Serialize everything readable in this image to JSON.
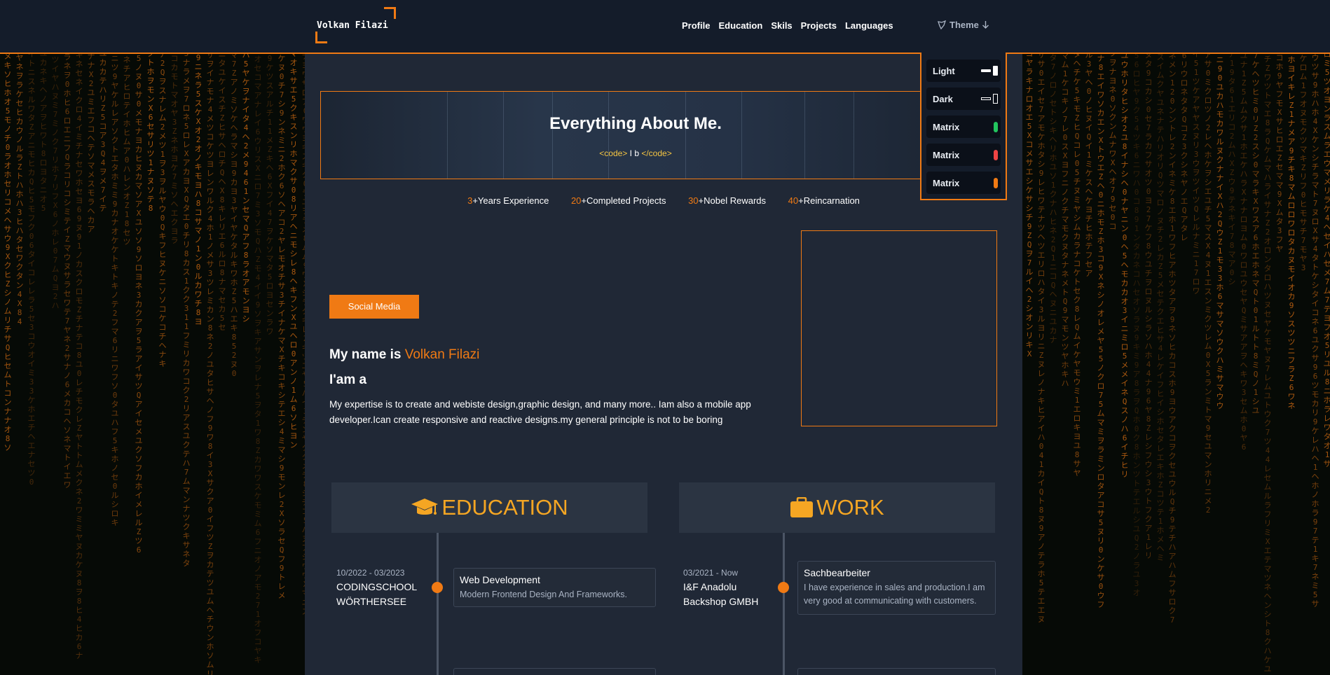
{
  "navbar": {
    "brand": "Volkan Filazi",
    "links": [
      "Profile",
      "Education",
      "Skils",
      "Projects",
      "Languages"
    ],
    "theme_label": "Theme"
  },
  "theme_menu": {
    "items": [
      {
        "label": "Light",
        "swatch": "light"
      },
      {
        "label": "Dark",
        "swatch": "dark"
      },
      {
        "label": "Matrix",
        "swatch": "#22c55e"
      },
      {
        "label": "Matrix",
        "swatch": "#ef4444"
      },
      {
        "label": "Matrix",
        "swatch": "#f07a14"
      }
    ]
  },
  "hero": {
    "title": "Everything About Me.",
    "code_open": "<code>",
    "code_text": "I b",
    "code_close": "</code>"
  },
  "stats": [
    {
      "num": "3",
      "label": "+Years Experience"
    },
    {
      "num": "20",
      "label": "+Completed Projects"
    },
    {
      "num": "30",
      "label": "+Nobel Rewards"
    },
    {
      "num": "40",
      "label": "+Reincarnation"
    }
  ],
  "about": {
    "social_button": "Social Media",
    "name_prefix": "My name is",
    "name": "Volkan Filazi",
    "iam": "I'am a",
    "bio": "My expertise is to create and webiste design,graphic design, and many more.. Iam also a mobile app developer.Ican create responsive and reactive designs.my general principle is not to be boring"
  },
  "education": {
    "title": "EDUCATION",
    "icon": "graduation-cap-icon",
    "entries": [
      {
        "date": "10/2022 - 03/2023",
        "place_line1": "CODINGSCHOOL",
        "place_line2": "WÖRTHERSEE",
        "title": "Web Development",
        "desc": "Modern Frontend Design And Frameworks."
      }
    ]
  },
  "work": {
    "title": "WORK",
    "icon": "briefcase-icon",
    "entries": [
      {
        "date": "03/2021 - Now",
        "place_line1": "I&F Anadolu",
        "place_line2": "Backshop GMBH",
        "title": "Sachbearbeiter",
        "desc": "I have experience in sales and production.I am very good at communicating with customers."
      }
    ]
  },
  "colors": {
    "accent": "#f07a14",
    "heading_gold": "#f5a623",
    "panel": "#202836",
    "navbar": "#141c2a",
    "matrix_glyph": "#f07a14"
  }
}
